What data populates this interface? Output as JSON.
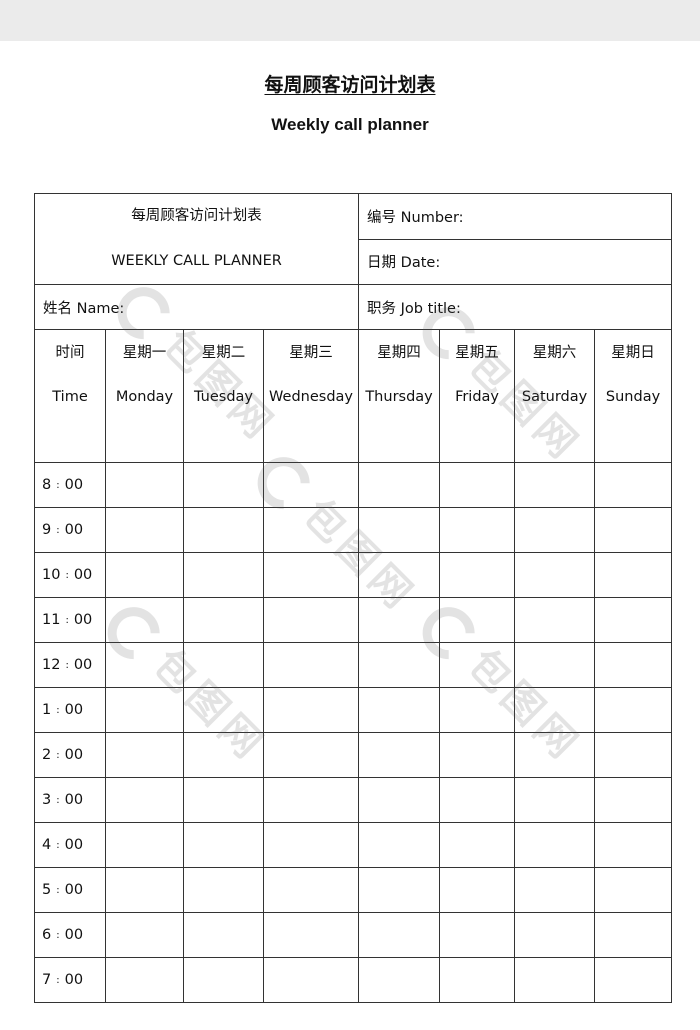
{
  "page": {
    "title_cn": "每周顾客访问计划表",
    "title_en": "Weekly call planner"
  },
  "header": {
    "cn_title": "每周顾客访问计划表",
    "en_title": "WEEKLY CALL PLANNER",
    "number_label": "编号 Number:",
    "date_label": "日期 Date:",
    "name_label": "姓名 Name:",
    "job_title_label": "职务 Job title:"
  },
  "columns": {
    "time": {
      "cn": "时间",
      "en": "Time"
    },
    "days": [
      {
        "cn": "星期一",
        "en": "Monday"
      },
      {
        "cn": "星期二",
        "en": "Tuesday"
      },
      {
        "cn": "星期三",
        "en": "Wednesday"
      },
      {
        "cn": "星期四",
        "en": "Thursday"
      },
      {
        "cn": "星期五",
        "en": "Friday"
      },
      {
        "cn": "星期六",
        "en": "Saturday"
      },
      {
        "cn": "星期日",
        "en": "Sunday"
      }
    ]
  },
  "time_slots": [
    {
      "hour": "8",
      "min": "00"
    },
    {
      "hour": "9",
      "min": "00"
    },
    {
      "hour": "10",
      "min": "00"
    },
    {
      "hour": "11",
      "min": "00"
    },
    {
      "hour": "12",
      "min": "00"
    },
    {
      "hour": "1",
      "min": "00"
    },
    {
      "hour": "2",
      "min": "00"
    },
    {
      "hour": "3",
      "min": "00"
    },
    {
      "hour": "4",
      "min": "00"
    },
    {
      "hour": "5",
      "min": "00"
    },
    {
      "hour": "6",
      "min": "00"
    },
    {
      "hour": "7",
      "min": "00"
    }
  ],
  "time_separator": ":",
  "watermark": {
    "text": "包图网",
    "icon": "drop-logo-icon"
  }
}
